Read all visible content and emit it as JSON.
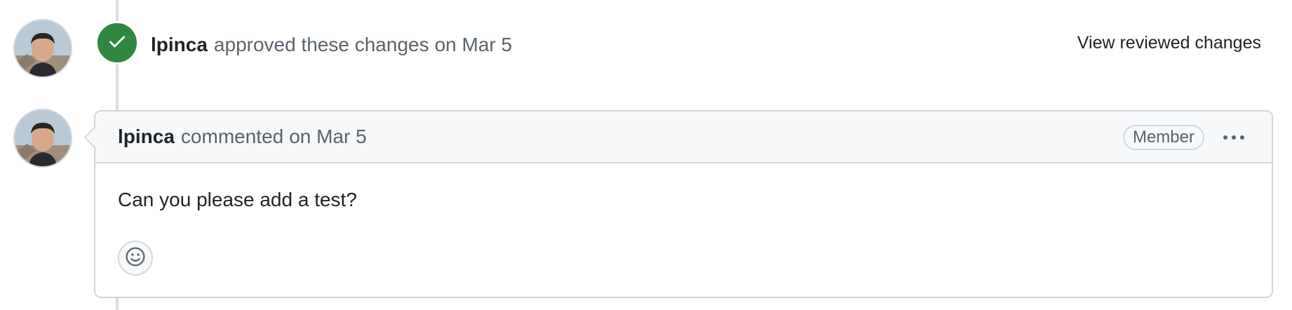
{
  "review": {
    "author": "lpinca",
    "action": "approved these changes",
    "date": "on Mar 5",
    "view_link": "View reviewed changes",
    "status_icon": "check-icon",
    "status_color": "#2f883f"
  },
  "comment": {
    "author": "lpinca",
    "action": "commented",
    "date": "on Mar 5",
    "role_badge": "Member",
    "menu_icon": "kebab-horizontal-icon",
    "body": "Can you please add a test?",
    "reaction_icon": "smiley-icon"
  },
  "colors": {
    "border": "#d0d7de",
    "header_bg": "#f6f8fa",
    "muted_text": "#59636e",
    "primary_text": "#1f2328"
  }
}
